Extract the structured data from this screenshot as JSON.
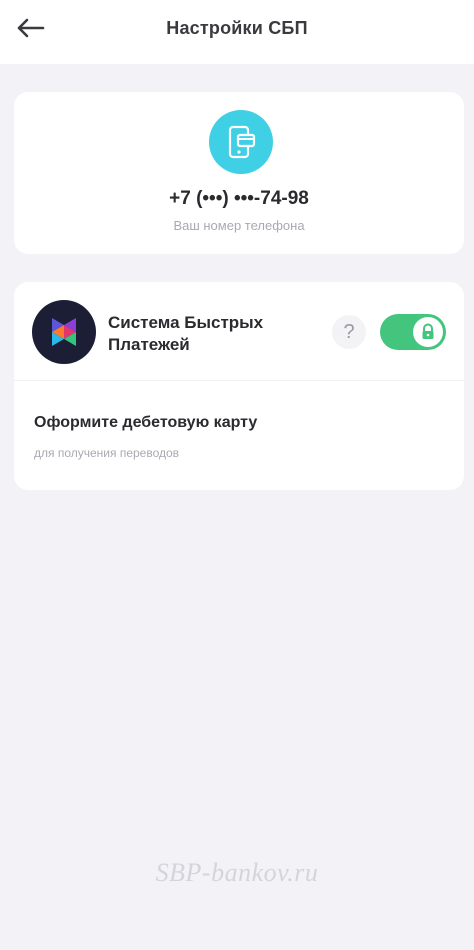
{
  "header": {
    "title": "Настройки СБП",
    "back_icon": "arrow-left-icon"
  },
  "phone_card": {
    "avatar_icon": "phone-card-icon",
    "avatar_color": "#3fd0e6",
    "phone_number": "+7 (•••) •••-74-98",
    "caption": "Ваш номер телефона"
  },
  "sbp_card": {
    "logo_icon": "sbp-logo-icon",
    "title": "Система Быстрых Платежей",
    "help_label": "?",
    "toggle": {
      "state": "on",
      "locked": true,
      "color": "#43c57e"
    },
    "hint_title": "Оформите дебетовую карту",
    "hint_subtitle": "для получения переводов"
  },
  "watermark": "SBP-bankov.ru"
}
